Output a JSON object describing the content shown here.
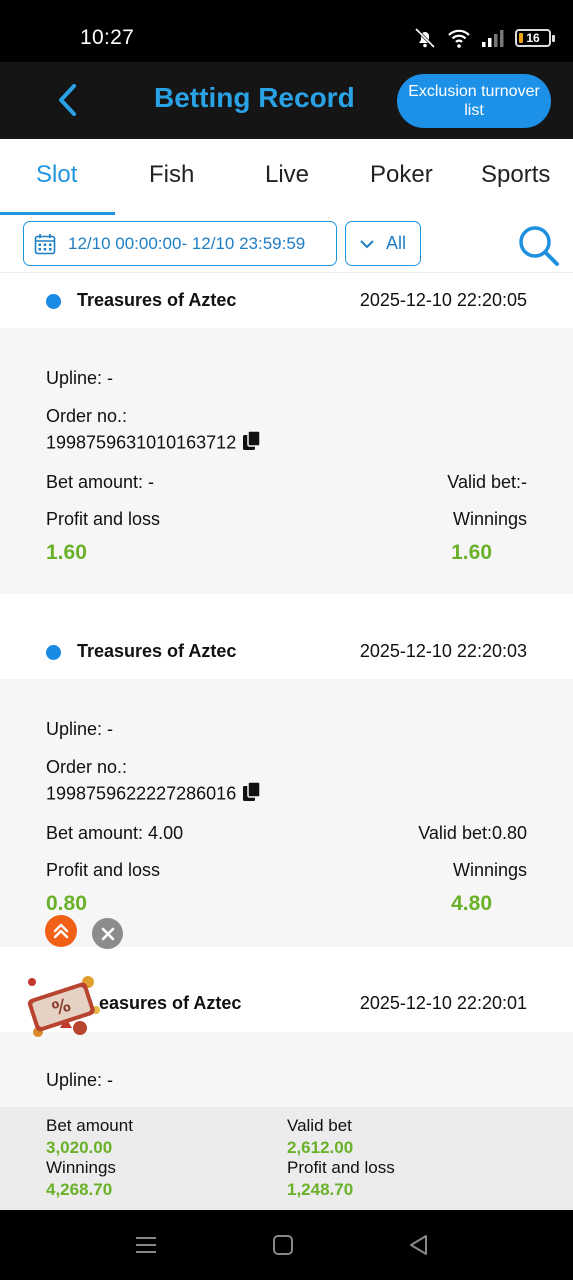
{
  "status": {
    "time": "10:27",
    "battery": "16"
  },
  "header": {
    "title": "Betting Record",
    "exclusion_button": "Exclusion turnover list"
  },
  "tabs": [
    {
      "label": "Slot",
      "active": true
    },
    {
      "label": "Fish",
      "active": false
    },
    {
      "label": "Live",
      "active": false
    },
    {
      "label": "Poker",
      "active": false
    },
    {
      "label": "Sports",
      "active": false
    }
  ],
  "filter": {
    "date_range": "12/10 00:00:00- 12/10 23:59:59",
    "type_selected": "All"
  },
  "records": [
    {
      "game": "Treasures of Aztec",
      "time": "2025-12-10 22:20:05",
      "upline": "Upline: -",
      "order_label": "Order no.:",
      "order_no": "1998759631010163712",
      "bet_amount": "Bet amount: -",
      "valid_bet": "Valid bet:-",
      "profit_label": "Profit and loss",
      "profit_value": "1.60",
      "winnings_label": "Winnings",
      "winnings_value": "1.60"
    },
    {
      "game": "Treasures of Aztec",
      "time": "2025-12-10 22:20:03",
      "upline": "Upline: -",
      "order_label": "Order no.:",
      "order_no": "1998759622227286016",
      "bet_amount": "Bet amount: 4.00",
      "valid_bet": "Valid bet:0.80",
      "profit_label": "Profit and loss",
      "profit_value": "0.80",
      "winnings_label": "Winnings",
      "winnings_value": "4.80"
    },
    {
      "game_visible": "easures of Aztec",
      "time": "2025-12-10 22:20:01",
      "upline": "Upline: -"
    }
  ],
  "summary": {
    "bet_amount_label": "Bet amount",
    "bet_amount_value": "3,020.00",
    "valid_bet_label": "Valid bet",
    "valid_bet_value": "2,612.00",
    "winnings_label": "Winnings",
    "winnings_value": "4,268.70",
    "profit_label": "Profit and loss",
    "profit_value": "1,248.70"
  },
  "colors": {
    "accent": "#2196e0",
    "green": "#6ab12a",
    "header_bg": "#151515"
  }
}
